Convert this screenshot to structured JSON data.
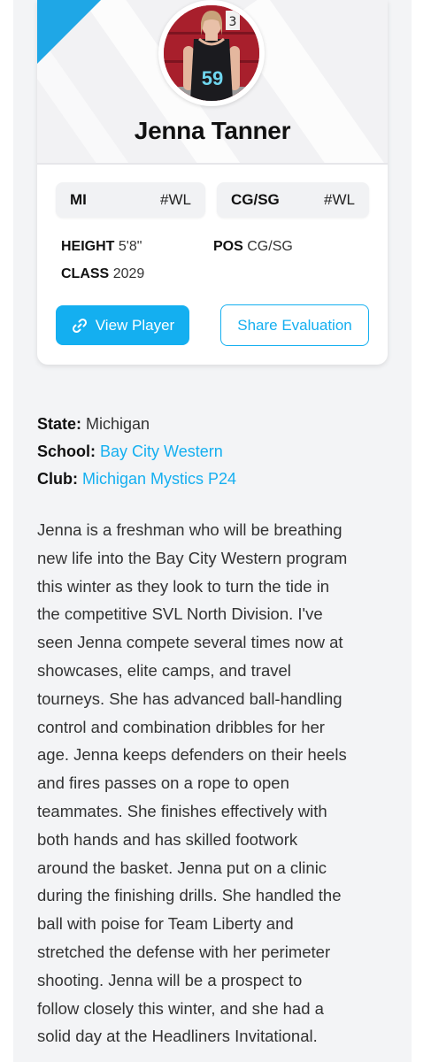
{
  "player": {
    "name": "Jenna Tanner",
    "jersey_number": "59"
  },
  "rankings": [
    {
      "label": "MI",
      "value": "#WL"
    },
    {
      "label": "CG/SG",
      "value": "#WL"
    }
  ],
  "stats": {
    "height_label": "HEIGHT",
    "height_value": "5'8\"",
    "pos_label": "POS",
    "pos_value": "CG/SG",
    "class_label": "CLASS",
    "class_value": "2029"
  },
  "buttons": {
    "view_player": "View Player",
    "share_evaluation": "Share Evaluation"
  },
  "info": {
    "state_label": "State:",
    "state_value": "Michigan",
    "school_label": "School:",
    "school_value": "Bay City Western",
    "club_label": "Club:",
    "club_value": "Michigan Mystics P24"
  },
  "bio_lines": [
    "Jenna is a freshman who will be breathing",
    "new life into the Bay City Western program",
    "this winter as they look to turn the tide in",
    "the competitive SVL North Division. I've",
    "seen Jenna compete several times now at",
    "showcases, elite camps, and travel",
    "tourneys. She has advanced ball-handling",
    "control and combination dribbles for her",
    "age. Jenna keeps defenders on their heels",
    "and fires passes on a rope to open",
    "teammates. She finishes effectively with",
    "both hands and has skilled footwork",
    "around the basket. Jenna put on a clinic",
    "during the finishing drills. She handled the",
    "ball with poise for Team Liberty and",
    "stretched the defense with her perimeter",
    "shooting. Jenna will be a prospect to",
    "follow closely this winter, and she had a",
    "solid day at the Headliners Invitational."
  ],
  "icons": {
    "view_player": "link-icon"
  },
  "colors": {
    "accent": "#14aff0",
    "corner_accent": "#1fa7e6",
    "background": "#f3f4f6"
  }
}
